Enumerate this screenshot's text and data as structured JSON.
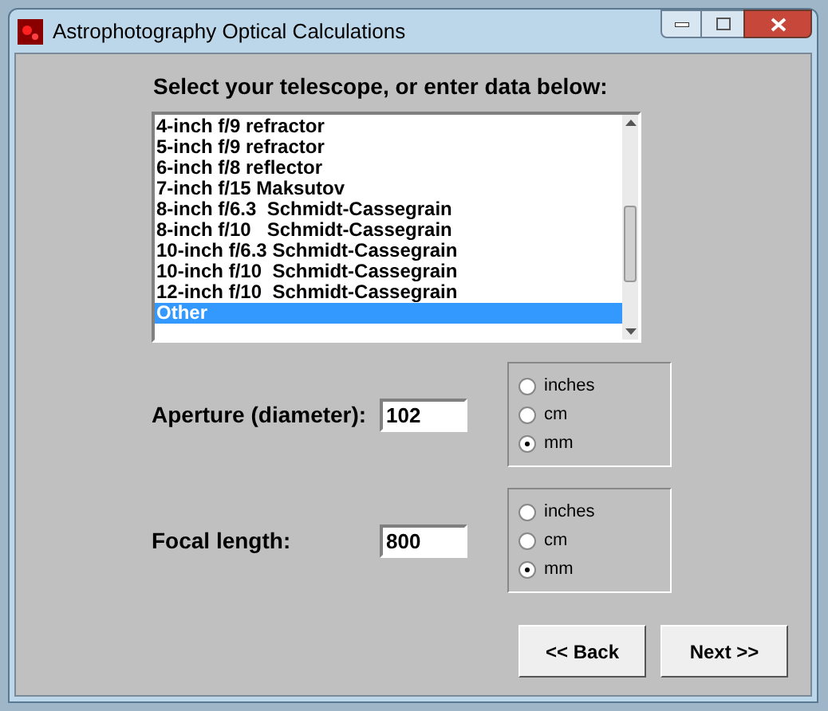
{
  "window": {
    "title": "Astrophotography Optical Calculations"
  },
  "prompt": "Select your telescope, or enter data below:",
  "telescopes": [
    {
      "label": "4-inch f/9 refractor",
      "selected": false
    },
    {
      "label": "5-inch f/9 refractor",
      "selected": false
    },
    {
      "label": "6-inch f/8 reflector",
      "selected": false
    },
    {
      "label": "7-inch f/15 Maksutov",
      "selected": false
    },
    {
      "label": "8-inch f/6.3  Schmidt-Cassegrain",
      "selected": false
    },
    {
      "label": "8-inch f/10   Schmidt-Cassegrain",
      "selected": false
    },
    {
      "label": "10-inch f/6.3 Schmidt-Cassegrain",
      "selected": false
    },
    {
      "label": "10-inch f/10  Schmidt-Cassegrain",
      "selected": false
    },
    {
      "label": "12-inch f/10  Schmidt-Cassegrain",
      "selected": false
    },
    {
      "label": "Other",
      "selected": true
    }
  ],
  "fields": [
    {
      "label": "Aperture (diameter):",
      "value": "102",
      "units": [
        {
          "label": "inches",
          "selected": false
        },
        {
          "label": "cm",
          "selected": false
        },
        {
          "label": "mm",
          "selected": true
        }
      ]
    },
    {
      "label": "Focal length:",
      "value": "800",
      "units": [
        {
          "label": "inches",
          "selected": false
        },
        {
          "label": "cm",
          "selected": false
        },
        {
          "label": "mm",
          "selected": true
        }
      ]
    }
  ],
  "buttons": [
    "<< Back",
    "Next >>"
  ]
}
